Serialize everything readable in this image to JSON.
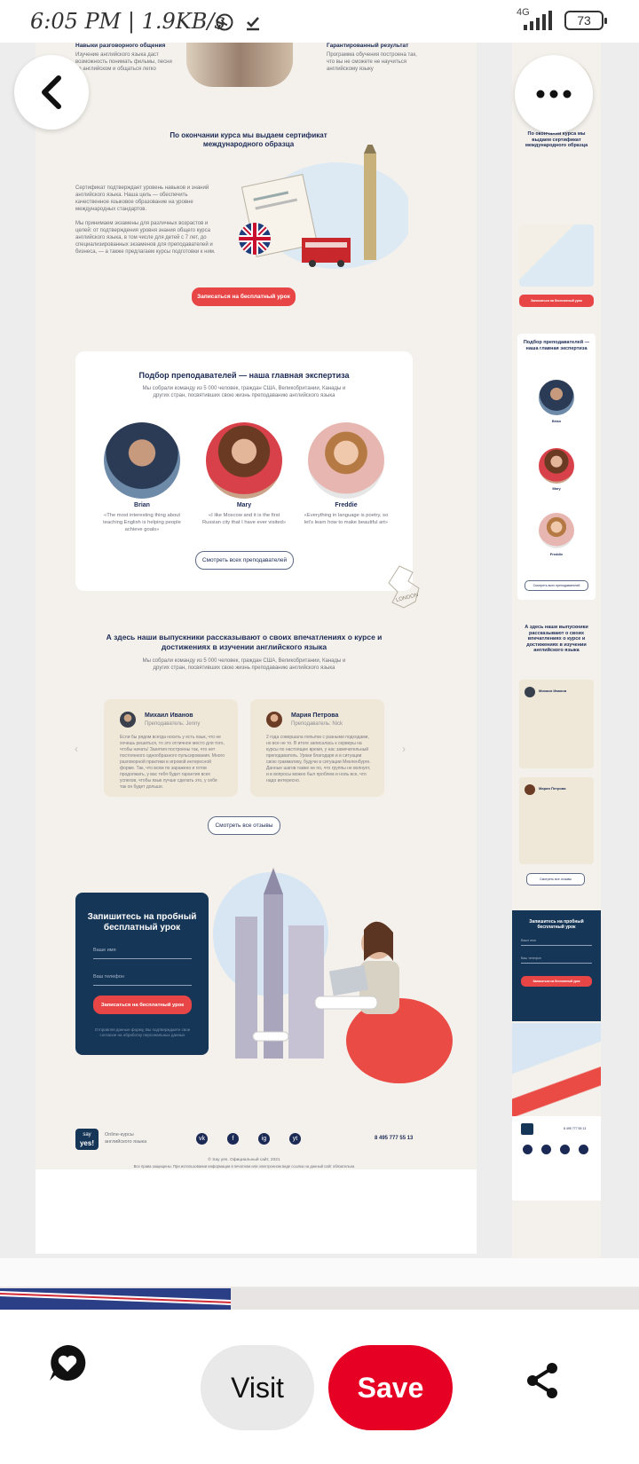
{
  "status_bar": {
    "time": "6:05 PM | 1.9KB/s",
    "network": "4G",
    "battery": "73"
  },
  "desktop": {
    "features": {
      "left_title": "Навыки разговорного общения",
      "left_text": "Изучение английского языка даст возможность понимать фильмы, песни на английском и общаться легко",
      "right_title": "Гарантированный результат",
      "right_text": "Программа обучения построена так, что вы не сможете не научиться английскому языку"
    },
    "certificate": {
      "title": "По окончании курса мы выдаем сертификат международного образца",
      "para1": "Сертификат подтверждает уровень навыков и знаний английского языка. Наша цель — обеспечить качественное языковое образование на уровне международных стандартов.",
      "para2": "Мы принимаем экзамены для различных возрастов и целей: от подтверждения уровня знания общего курса английского языка, в том числе для детей с 7 лет, до специализированных экзаменов для преподавателей и бизнеса, — а также предлагаем курсы подготовки к ним.",
      "button": "Записаться на бесплатный урок"
    },
    "teachers": {
      "title": "Подбор преподавателей — наша главная экспертиза",
      "subtitle": "Мы собрали команду из 5 000 человек, граждан США, Великобритании, Канады и других стран, посвятивших свою жизнь преподаванию английского языка",
      "items": [
        {
          "name": "Brian",
          "quote": "«The most interesting thing about teaching English is helping people achieve goals»"
        },
        {
          "name": "Mary",
          "quote": "«I like Moscow and it is the first Russian city that I have ever visited»"
        },
        {
          "name": "Freddie",
          "quote": "«Everything in language is poetry, so let's learn how to make beautiful art»"
        }
      ],
      "button": "Смотреть всех преподавателей",
      "stamp": "LONDON"
    },
    "reviews": {
      "title": "А здесь наши выпускники рассказывают о своих впечатлениях о курсе и достижениях в изучении английского языка",
      "subtitle": "Мы собрали команду из 5 000 человек, граждан США, Великобритании, Канады и других стран, посвятивших свою жизнь преподаванию английского языка",
      "items": [
        {
          "name": "Михаил Иванов",
          "teacher": "Преподаватель: Jenny",
          "text": "Если бы рядом всегда носить у есть язык, что не хочешь решиться, то это отличное место для того, чтобы начать! Занятия построены так, что нет постоянного однообразного пульсирования. Много разговорной практики в игровой интересной форме. Так, что всем по заражено и готов продолжать, у вас тебя будет гарантия всех успехов, чтобы язык лучше сделать это, у себя так он будет дольше."
        },
        {
          "name": "Мария Петрова",
          "teacher": "Преподаватель: Nick",
          "text": "2 года совершала попытки с разными подходами, но все не то. В итоге записалась к серверы на курсы по настоящее время, у нас замечательный преподаватель. Уроки благодаря и в ситуации свою грамматику, будучи в ситуации Мекленбурге. Данные шагов также не по, что группы не волнует, и в вопросы можно был проблем и ноль все, что надо интересно."
        }
      ],
      "button": "Смотреть все отзывы"
    },
    "form": {
      "title": "Запишитесь на пробный бесплатный урок",
      "name_placeholder": "Ваше имя",
      "phone_placeholder": "Ваш телефон",
      "button": "Записаться на бесплатный урок",
      "note": "Отправляя данные форму, Вы подтверждаете свое согласие на обработку персональных данных"
    },
    "footer": {
      "logo_top": "say",
      "logo_bottom": "yes!",
      "tagline": "Online-курсы английского языка",
      "phone": "8 495 777 55 13",
      "copyright": "© Say yes. Официальный сайт, 2021",
      "rights": "Все права защищены. При использовании информации в печатном или электронном виде ссылка на данный сайт обязательна",
      "socials": [
        "vk",
        "f",
        "ig",
        "yt"
      ]
    }
  },
  "mobile": {
    "certificate_title": "По окончании курса мы выдаем сертификат международного образца",
    "button": "Записаться на бесплатный урок",
    "teachers_title": "Подбор преподавателей — наша главная экспертиза",
    "teachers": [
      "Brian",
      "Mary",
      "Freddie"
    ],
    "teachers_button": "Смотреть всех преподавателей",
    "reviews_title": "А здесь наши выпускники рассказывают о своих впечатлениях о курсе и достижениях в изучении английского языка",
    "reviews": [
      "Михаил Иванов",
      "Мария Петрова"
    ],
    "reviews_button": "Смотреть все отзывы",
    "form_title": "Запишитесь на пробный бесплатный урок",
    "name_placeholder": "Ваше имя",
    "phone_placeholder": "Ваш телефон",
    "phone": "8 495 777 55 13"
  },
  "actions": {
    "visit": "Visit",
    "save": "Save"
  },
  "colors": {
    "save": "#e60023",
    "accent_red": "#e84646",
    "navy": "#163657"
  }
}
